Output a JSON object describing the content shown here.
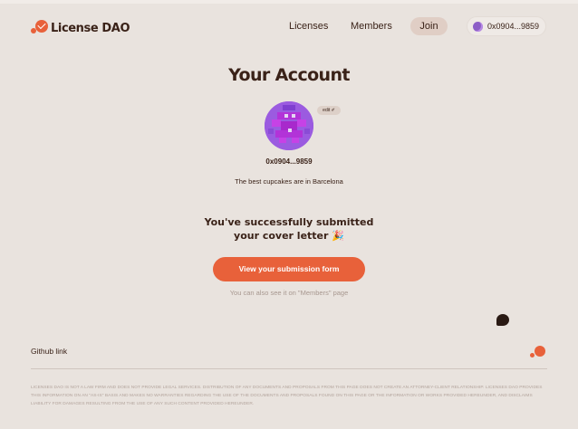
{
  "brand": {
    "name": "License DAO",
    "accent": "#e8613a"
  },
  "nav": {
    "licenses": "Licenses",
    "members": "Members",
    "join": "Join"
  },
  "wallet": {
    "address": "0x0904...9859"
  },
  "page": {
    "title": "Your Account"
  },
  "profile": {
    "edit_label": "edit ✐",
    "address": "0x0904...9859",
    "bio": "The best cupcakes are in Barcelona"
  },
  "success": {
    "line1": "You've successfully submitted",
    "line2": "your cover letter 🎉"
  },
  "cta": {
    "label": "View your submission form"
  },
  "hint": {
    "text": "You can also see it on \"Members\" page"
  },
  "footer": {
    "github": "Github link",
    "disclaimer": "Licenses DAO is not a law firm and does not provide legal services. Distribution of any documents and proposals from this page does not create an attorney-client relationship. Licenses DAO provides this information on an \"as-is\" basis and makes no warranties regarding the use of the documents and proposals found on this page or the information or works provided hereunder, and disclaims liability for damages resulting from the use of any such content provided hereunder."
  }
}
